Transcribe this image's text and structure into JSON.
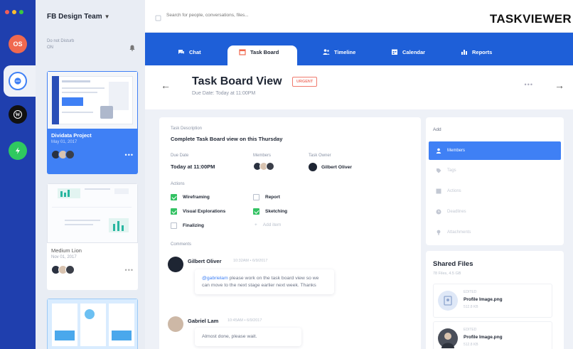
{
  "colors": {
    "rail": "#1f3fae",
    "nav": "#1e5fd8",
    "accent": "#3f80f5",
    "urgent": "#f07a6e",
    "checked": "#33c263"
  },
  "window_dots": [
    "#f25f58",
    "#fbbe2e",
    "#3ac840"
  ],
  "rail_apps": [
    {
      "label": "OS",
      "color": "#f0694f",
      "icon": "avatar-icon"
    },
    {
      "label": "",
      "color": "#3f80f5",
      "icon": "chat-bubble-icon"
    },
    {
      "label": "",
      "color": "#111111",
      "icon": "wordpress-icon"
    },
    {
      "label": "",
      "color": "#2fc95f",
      "icon": "lightning-icon"
    }
  ],
  "sidebar": {
    "team_name": "FB Design Team",
    "dnd_label": "Do not Disturb",
    "dnd_value": "ON",
    "projects": [
      {
        "title": "Dividata Project",
        "date": "May 01, 2017",
        "active": true
      },
      {
        "title": "Medium Lion",
        "date": "Nov 01, 2017",
        "active": false
      },
      {
        "title": "",
        "date": "",
        "active": false
      }
    ]
  },
  "topbar": {
    "search_placeholder": "Search for people, conversations, files...",
    "logo": "TASKVIEWER"
  },
  "tabs": [
    {
      "label": "Chat",
      "icon": "chat-icon",
      "active": false
    },
    {
      "label": "Task Board",
      "icon": "calendar-board-icon",
      "active": true
    },
    {
      "label": "Timeline",
      "icon": "people-icon",
      "active": false
    },
    {
      "label": "Calendar",
      "icon": "calendar-icon",
      "active": false
    },
    {
      "label": "Reports",
      "icon": "bar-chart-icon",
      "active": false
    }
  ],
  "header": {
    "title": "Task Board View",
    "badge": "URGENT",
    "due": "Due Date: Today at 11:00PM"
  },
  "task": {
    "desc_label": "Task Description",
    "desc": "Complete Task Board view on this Thursday",
    "due_label": "Due Date",
    "due_value": "Today at 11:00PM",
    "members_label": "Members",
    "owner_label": "Task Owner",
    "owner_name": "Gilbert Oliver",
    "actions_label": "Actions",
    "actions": [
      {
        "label": "Wireframing",
        "checked": true
      },
      {
        "label": "Report",
        "checked": false
      },
      {
        "label": "Visual Explorations",
        "checked": true
      },
      {
        "label": "Sketching",
        "checked": true
      },
      {
        "label": "Finalizing",
        "checked": false
      }
    ],
    "add_item": "Add item"
  },
  "comments": {
    "label": "Comments",
    "items": [
      {
        "author": "Gilbert Oliver",
        "time": "10:32AM • 6/9/2017",
        "mention": "@gabrielam",
        "text": " please work on the task board view so we can move to the next stage earlier next week. Thanks"
      },
      {
        "author": "Gabriel Lam",
        "time": "10:45AM • 6/9/2017",
        "mention": "",
        "text": "Almost done, please wait."
      }
    ]
  },
  "add_panel": {
    "title": "Add",
    "items": [
      {
        "label": "Members",
        "icon": "person-icon",
        "active": true
      },
      {
        "label": "Tags",
        "icon": "tag-icon",
        "active": false
      },
      {
        "label": "Actions",
        "icon": "checkbox-icon",
        "active": false
      },
      {
        "label": "Deadlines",
        "icon": "clock-icon",
        "active": false
      },
      {
        "label": "Attachments",
        "icon": "paperclip-icon",
        "active": false
      }
    ]
  },
  "shared_files": {
    "title": "Shared Files",
    "count": "78 Files, 4.5 GB",
    "files": [
      {
        "label": "EDITED",
        "name": "Profile Image.png",
        "size": "512.8 KB"
      },
      {
        "label": "EDITED",
        "name": "Profile Image.png",
        "size": "512.8 KB"
      }
    ]
  }
}
